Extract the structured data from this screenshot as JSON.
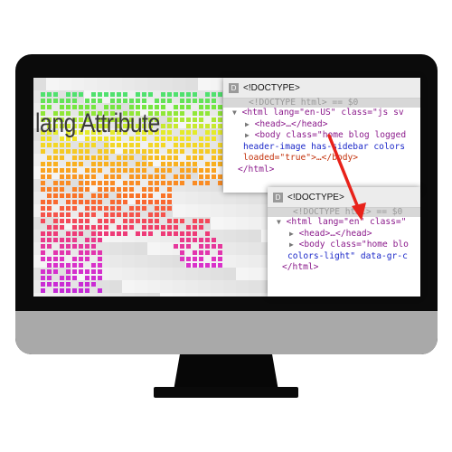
{
  "website": {
    "title_text": "lang Attribute"
  },
  "panel_top": {
    "badge": "D",
    "title": "<!DOCTYPE>",
    "selected_line": "<!DOCTYPE html> == $0",
    "lines": [
      "<html lang=\"en-US\" class=\"js sv",
      "<head>…</head>",
      "<body class=\"home blog logged",
      "header-image has-sidebar colors",
      "loaded=\"true\">…</body>",
      "</html>"
    ]
  },
  "panel_bottom": {
    "badge": "D",
    "title": "<!DOCTYPE>",
    "selected_line": "<!DOCTYPE html> == $0",
    "lines": [
      "<html lang=\"en\" class=\"",
      "<head>…</head>",
      "<body class=\"home blo",
      "colors-light\" data-gr-c",
      "</html>"
    ]
  },
  "colors": {
    "arrow": "#e8221a",
    "monitor": "#0b0b0b",
    "chin": "#a9a9a9"
  }
}
